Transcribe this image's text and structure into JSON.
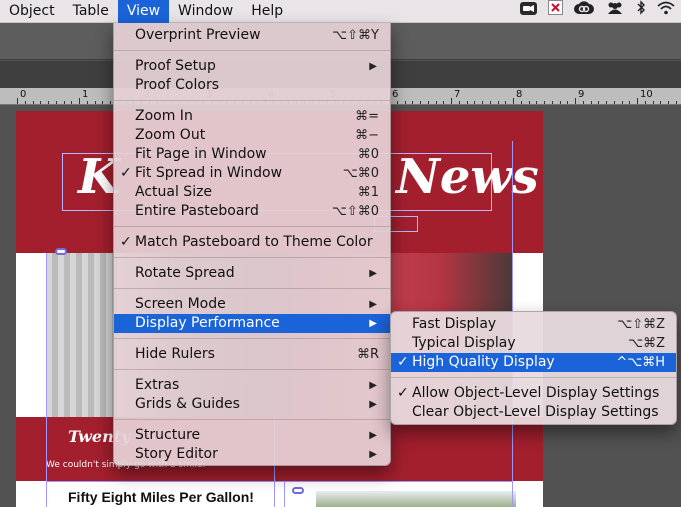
{
  "menubar": {
    "items": [
      "Object",
      "Table",
      "View",
      "Window",
      "Help"
    ],
    "active": "View",
    "status_icons": [
      "zoom-icon",
      "adobe-icon",
      "creative-cloud-icon",
      "users-icon",
      "bluetooth-icon",
      "wifi-icon"
    ]
  },
  "ruler": {
    "labels": [
      "0",
      "1",
      "2",
      "3",
      "4",
      "5",
      "6",
      "7",
      "8",
      "9",
      "10"
    ]
  },
  "document": {
    "masthead_left": "K",
    "masthead_right": "News",
    "band2_title": "Twenty",
    "band2_sub": "We couldn't simply go with a smile.",
    "headline": "Fifty Eight Miles Per Gallon!",
    "accent_color": "#a31f2e"
  },
  "view_menu": {
    "items": [
      {
        "label": "Overprint Preview",
        "shortcut": "⌥⇧⌘Y"
      },
      {
        "label": "Proof Setup",
        "submenu": true
      },
      {
        "label": "Proof Colors"
      },
      {
        "label": "Zoom In",
        "shortcut": "⌘="
      },
      {
        "label": "Zoom Out",
        "shortcut": "⌘−"
      },
      {
        "label": "Fit Page in Window",
        "shortcut": "⌘0"
      },
      {
        "label": "Fit Spread in Window",
        "shortcut": "⌥⌘0",
        "checked": true
      },
      {
        "label": "Actual Size",
        "shortcut": "⌘1"
      },
      {
        "label": "Entire Pasteboard",
        "shortcut": "⌥⇧⌘0"
      },
      {
        "label": "Match Pasteboard to Theme Color",
        "checked": true
      },
      {
        "label": "Rotate Spread",
        "submenu": true
      },
      {
        "label": "Screen Mode",
        "submenu": true
      },
      {
        "label": "Display Performance",
        "submenu": true,
        "highlighted": true
      },
      {
        "label": "Hide Rulers",
        "shortcut": "⌘R"
      },
      {
        "label": "Extras",
        "submenu": true
      },
      {
        "label": "Grids & Guides",
        "submenu": true
      },
      {
        "label": "Structure",
        "submenu": true
      },
      {
        "label": "Story Editor",
        "submenu": true
      }
    ],
    "checkmark": "✓",
    "arrow": "▶"
  },
  "display_performance_submenu": {
    "items": [
      {
        "label": "Fast Display",
        "shortcut": "⌥⇧⌘Z"
      },
      {
        "label": "Typical Display",
        "shortcut": "⌥⌘Z"
      },
      {
        "label": "High Quality Display",
        "shortcut": "^⌥⌘H",
        "checked": true,
        "highlighted": true
      },
      {
        "label": "Allow Object-Level Display Settings",
        "checked": true
      },
      {
        "label": "Clear Object-Level Display Settings"
      }
    ]
  },
  "colors": {
    "highlight": "#1a63d8",
    "menu_bg": "#e4d0d6"
  }
}
